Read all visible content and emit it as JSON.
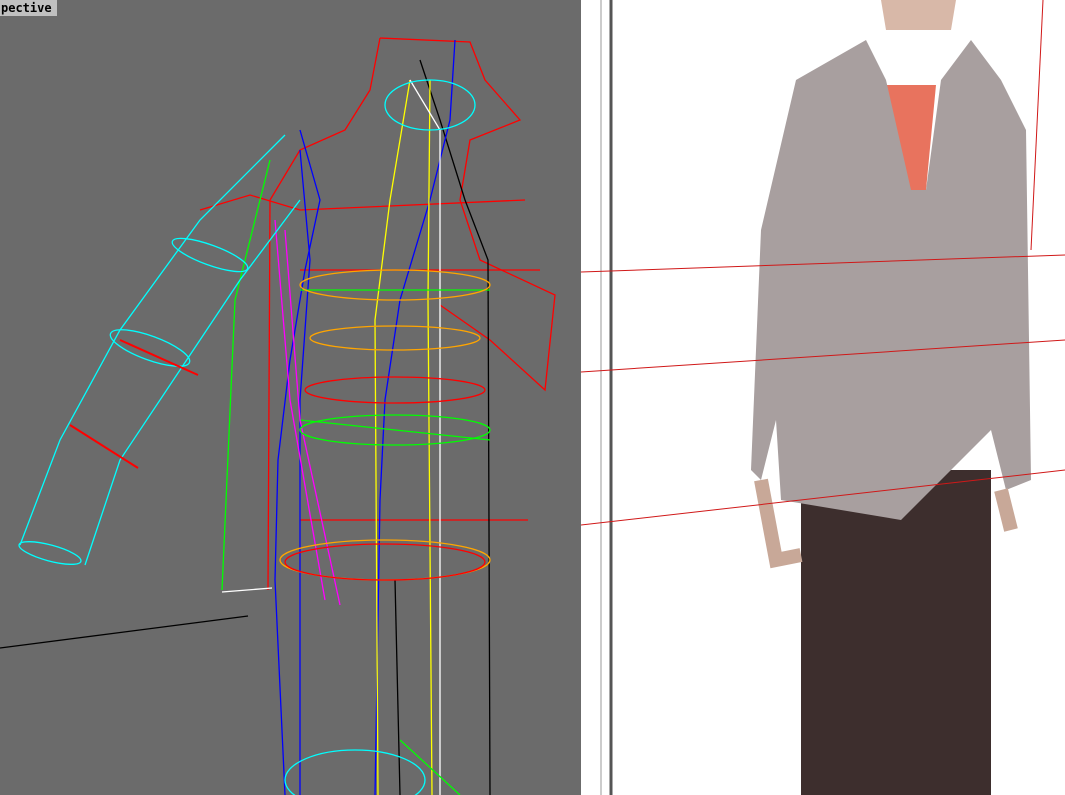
{
  "viewport": {
    "label": "pective",
    "background": "#6b6b6b"
  },
  "wire_colors": {
    "red": "#ff0000",
    "blue": "#0000ff",
    "cyan": "#00ffff",
    "yellow": "#ffff00",
    "green": "#00ff00",
    "magenta": "#ff00ff",
    "orange": "#ffa500",
    "black": "#000000",
    "white": "#ffffff"
  },
  "photo": {
    "cardigan_color": "#a89f9f",
    "blouse_color": "#e8735e",
    "trousers_color": "#3d2e2d",
    "guide_line_color": "#d01818"
  }
}
